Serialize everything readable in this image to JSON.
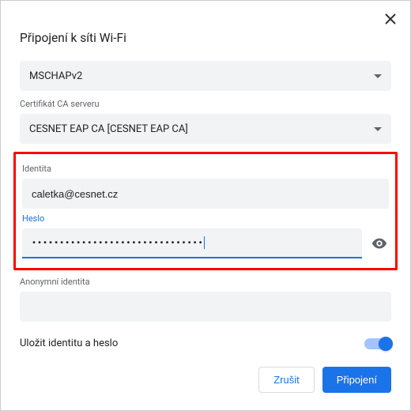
{
  "dialog": {
    "title": "Připojení k síti Wi-Fi"
  },
  "fields": {
    "phase2": {
      "value": "MSCHAPv2"
    },
    "ca_cert": {
      "label": "Certifikát CA serveru",
      "value": "CESNET EAP CA [CESNET EAP CA]"
    },
    "identity": {
      "label": "Identita",
      "value": "caletka@cesnet.cz"
    },
    "password": {
      "label": "Heslo",
      "masked": "•••••••••••••••••••••••••••••••"
    },
    "anon_identity": {
      "label": "Anonymní identita",
      "value": ""
    }
  },
  "save": {
    "label": "Uložit identitu a heslo",
    "on": true
  },
  "buttons": {
    "cancel": "Zrušit",
    "connect": "Připojení"
  }
}
